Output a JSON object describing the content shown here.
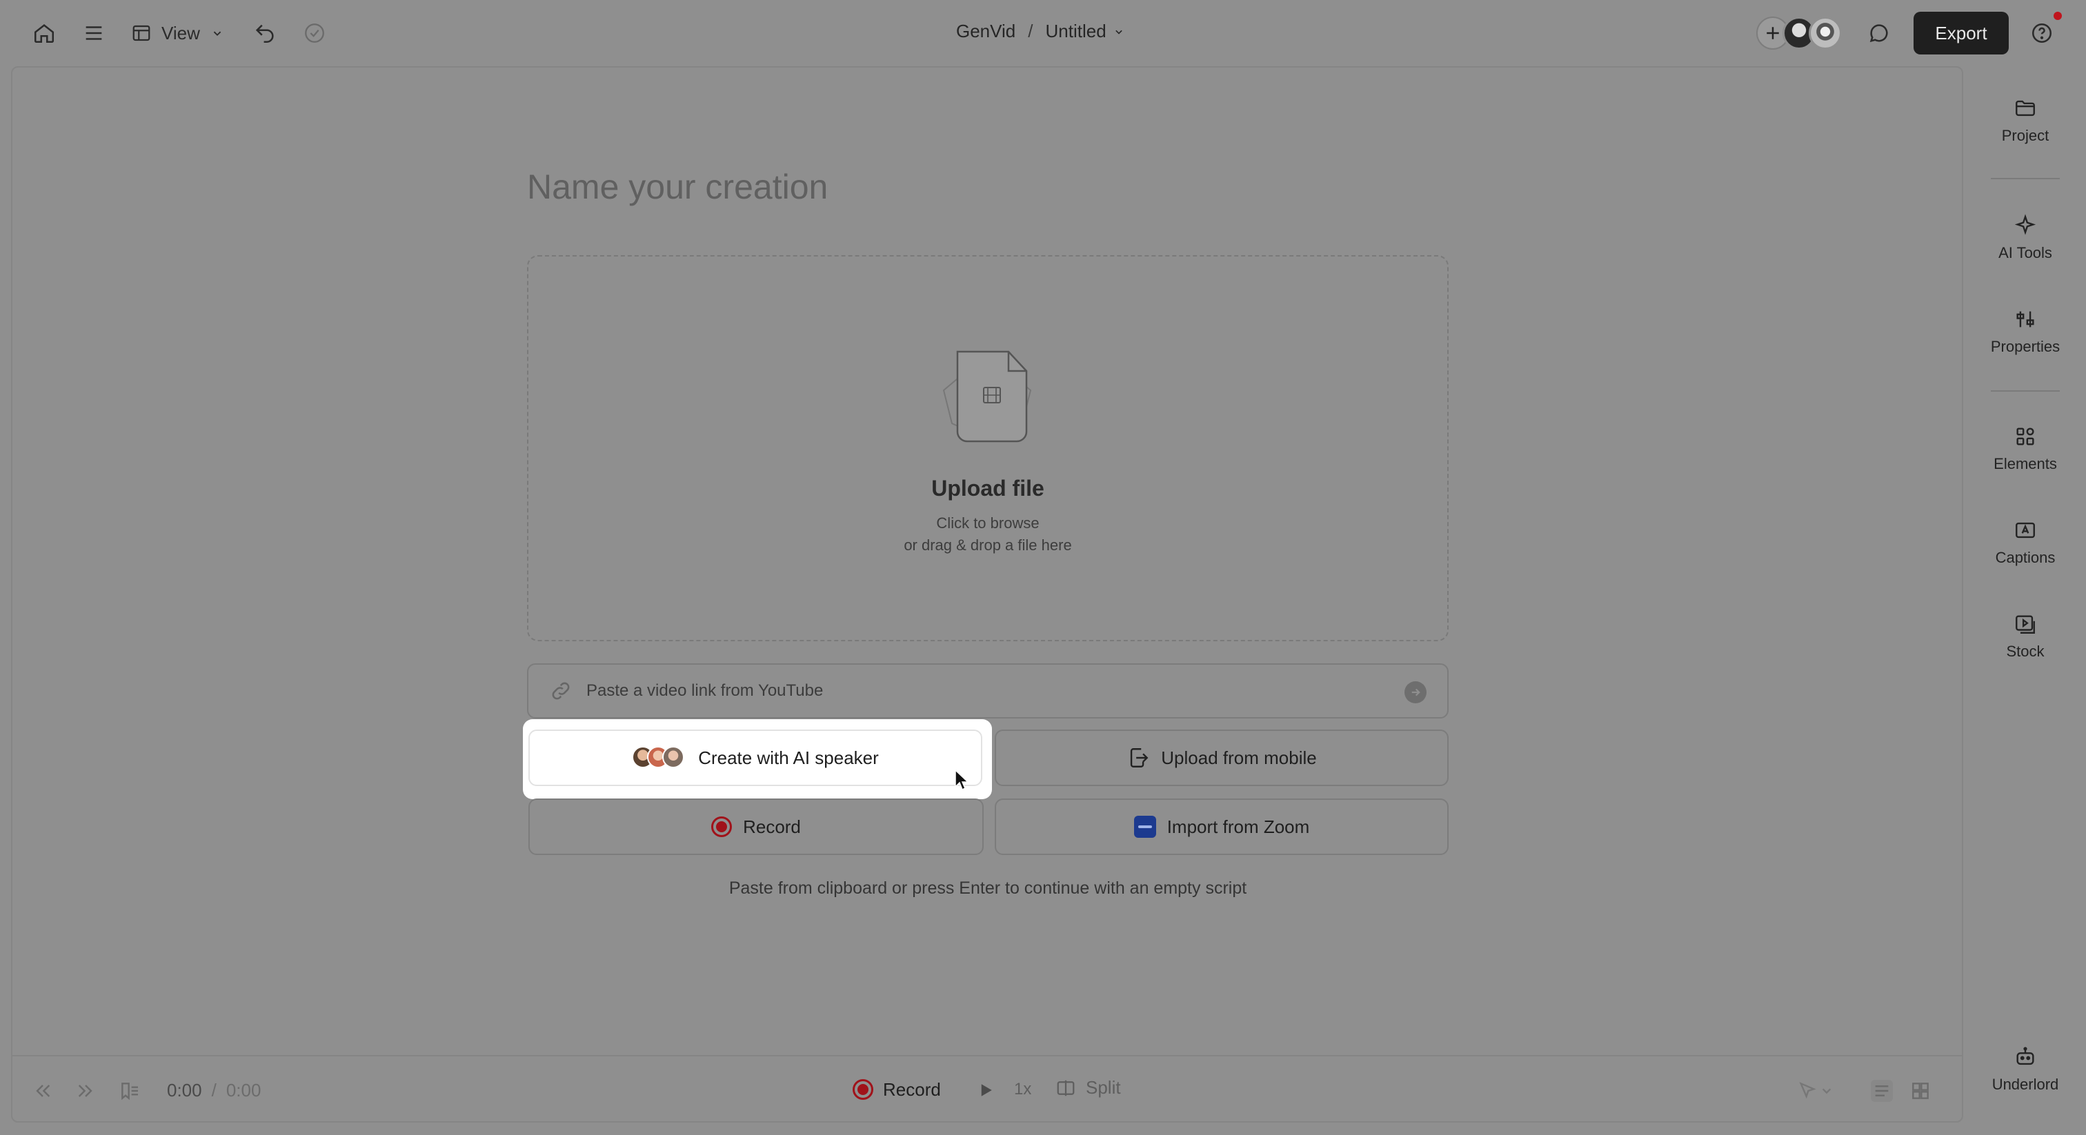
{
  "topbar": {
    "view_label": "View",
    "breadcrumb_app": "GenVid",
    "breadcrumb_sep": "/",
    "project_title": "Untitled",
    "export_label": "Export"
  },
  "main": {
    "name_placeholder": "Name your creation",
    "upload_title": "Upload file",
    "upload_sub1": "Click to browse",
    "upload_sub2": "or drag & drop a file here",
    "youtube_placeholder": "Paste a video link from YouTube",
    "ai_speaker_label": "Create with AI speaker",
    "upload_mobile_label": "Upload from mobile",
    "record_label": "Record",
    "import_zoom_label": "Import from Zoom",
    "hint": "Paste from clipboard or press Enter to continue with an empty script"
  },
  "bottombar": {
    "time_current": "0:00",
    "time_sep": "/",
    "time_total": "0:00",
    "record_label": "Record",
    "speed": "1x",
    "split_label": "Split"
  },
  "sidebar": {
    "items": [
      {
        "label": "Project",
        "icon": "folder-icon"
      },
      {
        "label": "AI Tools",
        "icon": "sparkle-icon"
      },
      {
        "label": "Properties",
        "icon": "sliders-icon"
      },
      {
        "label": "Elements",
        "icon": "shapes-icon"
      },
      {
        "label": "Captions",
        "icon": "captions-icon"
      },
      {
        "label": "Stock",
        "icon": "stock-media-icon"
      },
      {
        "label": "Underlord",
        "icon": "robot-icon"
      }
    ]
  },
  "colors": {
    "overlay_bg": "#8f8f8f",
    "record_red": "#a0121a",
    "export_bg": "#1f1f1f",
    "notification": "#c0141d",
    "zoom_blue": "#1c3a8f"
  }
}
